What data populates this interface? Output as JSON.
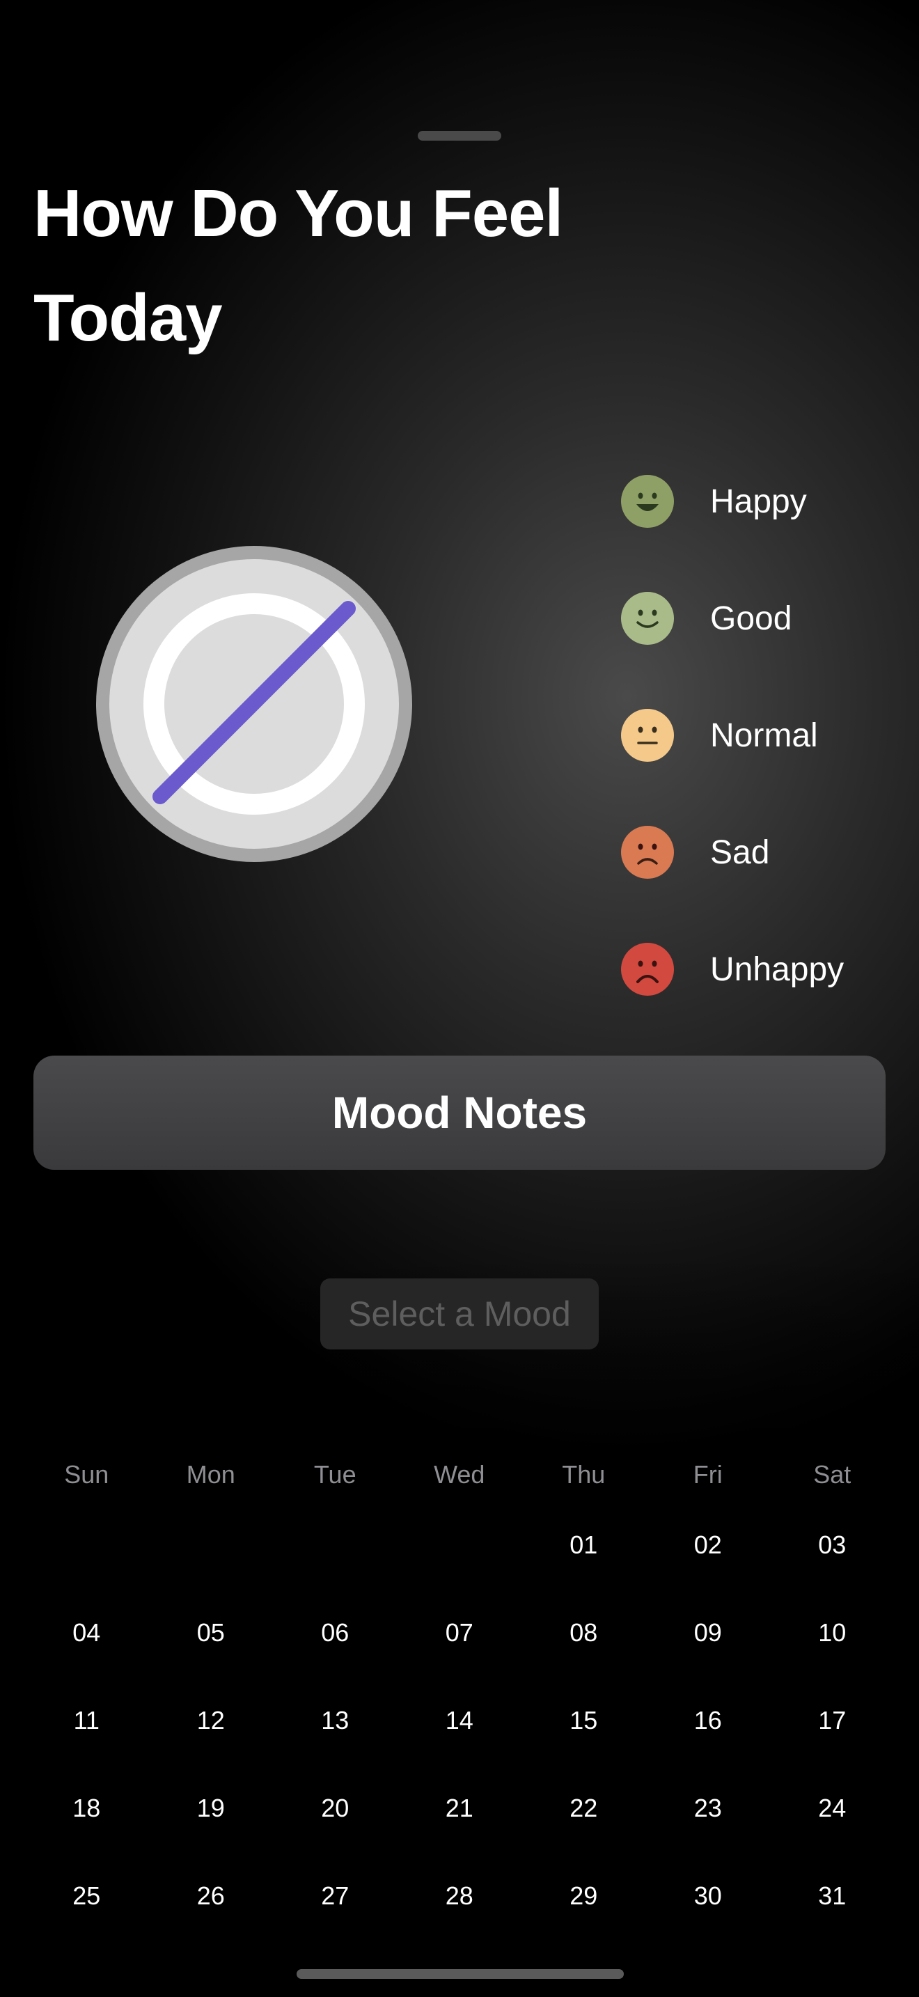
{
  "title": "How Do You Feel Today",
  "dial": {
    "icon": "mood-dial-empty-icon",
    "slash_color": "#6a5acd"
  },
  "moods": [
    {
      "label": "Happy",
      "icon": "happy-face-icon",
      "color": "#8fa066",
      "expression": "big-smile"
    },
    {
      "label": "Good",
      "icon": "good-face-icon",
      "color": "#aabb8a",
      "expression": "smile"
    },
    {
      "label": "Normal",
      "icon": "normal-face-icon",
      "color": "#f5c98a",
      "expression": "flat"
    },
    {
      "label": "Sad",
      "icon": "sad-face-icon",
      "color": "#d97a52",
      "expression": "frown"
    },
    {
      "label": "Unhappy",
      "icon": "unhappy-face-icon",
      "color": "#d2493f",
      "expression": "big-frown"
    }
  ],
  "notes_button": "Mood Notes",
  "select_mood_button": "Select a Mood",
  "calendar": {
    "weekdays": [
      "Sun",
      "Mon",
      "Tue",
      "Wed",
      "Thu",
      "Fri",
      "Sat"
    ],
    "weeks": [
      [
        "",
        "",
        "",
        "",
        "01",
        "02",
        "03"
      ],
      [
        "04",
        "05",
        "06",
        "07",
        "08",
        "09",
        "10"
      ],
      [
        "11",
        "12",
        "13",
        "14",
        "15",
        "16",
        "17"
      ],
      [
        "18",
        "19",
        "20",
        "21",
        "22",
        "23",
        "24"
      ],
      [
        "25",
        "26",
        "27",
        "28",
        "29",
        "30",
        "31"
      ]
    ]
  }
}
